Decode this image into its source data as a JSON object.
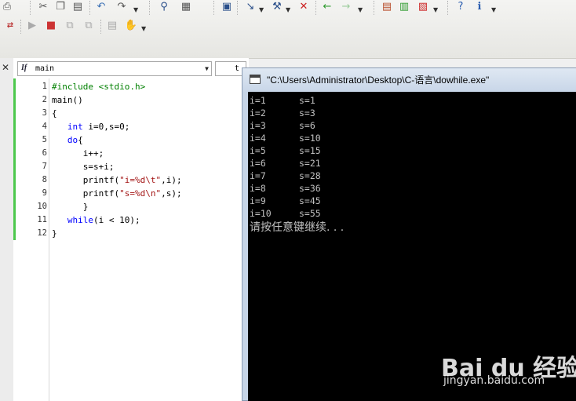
{
  "toolbar": {
    "row1_icons": [
      "print-icon",
      "cut-icon",
      "copy-icon",
      "paste-icon",
      "undo-icon",
      "redo-icon",
      "find-icon",
      "find-in-files-icon",
      "compile-icon",
      "build-icon",
      "stop-build-icon",
      "back-icon",
      "forward-icon",
      "workspace-icon",
      "output-icon",
      "window-list-icon",
      "help-icon",
      "info-icon"
    ],
    "row2_icons": [
      "wizard-icon",
      "run-icon",
      "stop-icon",
      "debug-step-icon",
      "debug-step2-icon",
      "breakpoint-icon",
      "hand-icon"
    ]
  },
  "editor": {
    "function_combo": "main",
    "second_combo": "t",
    "line_numbers": [
      "1",
      "2",
      "3",
      "4",
      "5",
      "6",
      "7",
      "8",
      "9",
      "10",
      "11",
      "12"
    ]
  },
  "console": {
    "title": "\"C:\\Users\\Administrator\\Desktop\\C-语言\\dowhile.exe\"",
    "output": [
      {
        "i": "i=1",
        "s": "s=1"
      },
      {
        "i": "i=2",
        "s": "s=3"
      },
      {
        "i": "i=3",
        "s": "s=6"
      },
      {
        "i": "i=4",
        "s": "s=10"
      },
      {
        "i": "i=5",
        "s": "s=15"
      },
      {
        "i": "i=6",
        "s": "s=21"
      },
      {
        "i": "i=7",
        "s": "s=28"
      },
      {
        "i": "i=8",
        "s": "s=36"
      },
      {
        "i": "i=9",
        "s": "s=45"
      },
      {
        "i": "i=10",
        "s": "s=55"
      }
    ],
    "prompt": "请按任意键继续. . ."
  },
  "watermark": {
    "logo": "Bai du 经验",
    "url": "jingyan.baidu.com"
  }
}
